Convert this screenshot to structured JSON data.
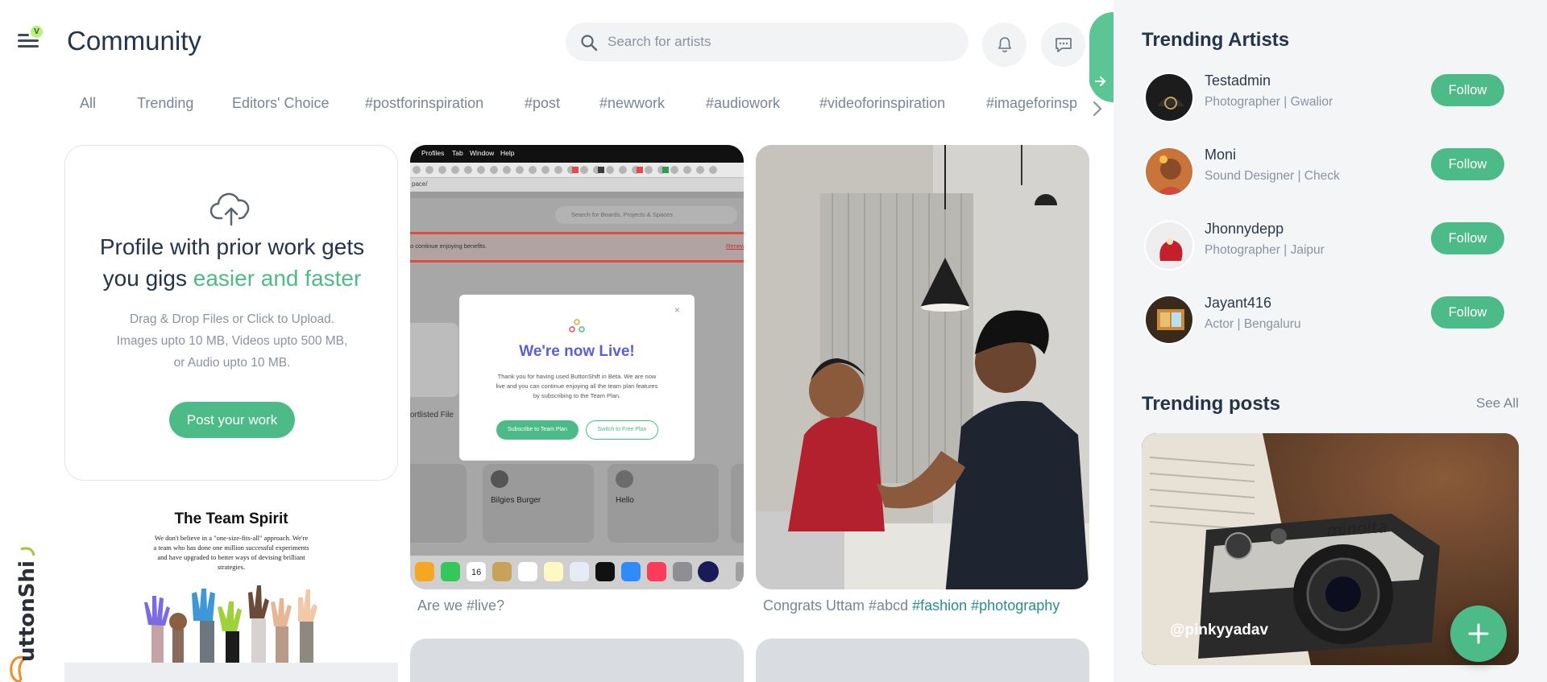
{
  "header": {
    "menu_badge": "V",
    "title": "Community",
    "search_placeholder": "Search for artists"
  },
  "tabs": [
    "All",
    "Trending",
    "Editors' Choice",
    "#postforinspiration",
    "#post",
    "#newwork",
    "#audiowork",
    "#videoforinspiration",
    "#imageforinsp"
  ],
  "upload_card": {
    "heading_plain": "Profile with prior work gets you gigs ",
    "heading_accent": "easier and faster",
    "description": "Drag & Drop Files or Click to Upload. Images upto 10 MB, Videos upto 500 MB, or Audio upto 10 MB.",
    "button": "Post your work"
  },
  "team_card": {
    "title": "The Team Spirit",
    "text": "We don't believe in a \"one-size-fits-all\" approach. We're a team who has done one million successful experiments and have upgraded to better ways of devising brilliant strategies."
  },
  "screenshot_post": {
    "menubar": [
      "Profiles",
      "Tab",
      "Window",
      "Help"
    ],
    "url_fragment": "pace/",
    "inner_search_placeholder": "Search for Boards, Projects & Spaces",
    "banner_text": "o continue enjoying benefits.",
    "banner_link": "Renew",
    "shortlisted_label": "ortlisted File",
    "modal": {
      "title": "We're now Live!",
      "body": "Thank you for having used ButtonShift in Beta. We are now live and you can continue enjoying all the team plan features by subscribing to the Team Plan.",
      "primary_button": "Subscribe to Team Plan",
      "secondary_button": "Switch to Free Plan"
    },
    "tiles": [
      "Bilgies Burger",
      "Hello"
    ],
    "dock_date": "16",
    "caption": "Are we #live?"
  },
  "photo_post": {
    "caption_plain": "Congrats Uttam #abcd ",
    "caption_tags": "#fashion #photography"
  },
  "sidebar": {
    "trending_artists_title": "Trending Artists",
    "artists": [
      {
        "name": "Testadmin",
        "role": "Photographer | Gwalior",
        "follow": "Follow"
      },
      {
        "name": "Moni",
        "role": "Sound Designer | Check",
        "follow": "Follow"
      },
      {
        "name": "Jhonnydepp",
        "role": "Photographer | Jaipur",
        "follow": "Follow"
      },
      {
        "name": "Jayant416",
        "role": "Actor | Bengaluru",
        "follow": "Follow"
      }
    ],
    "trending_posts_title": "Trending posts",
    "see_all": "See All",
    "post_user": "@pinkyyadav",
    "camera_brand": "minolta"
  },
  "brand": {
    "name": "ButtonShift"
  },
  "colors": {
    "accent": "#4dbb87",
    "heading": "#24344a",
    "muted": "#7a8593",
    "tag": "#2a8c8c"
  }
}
